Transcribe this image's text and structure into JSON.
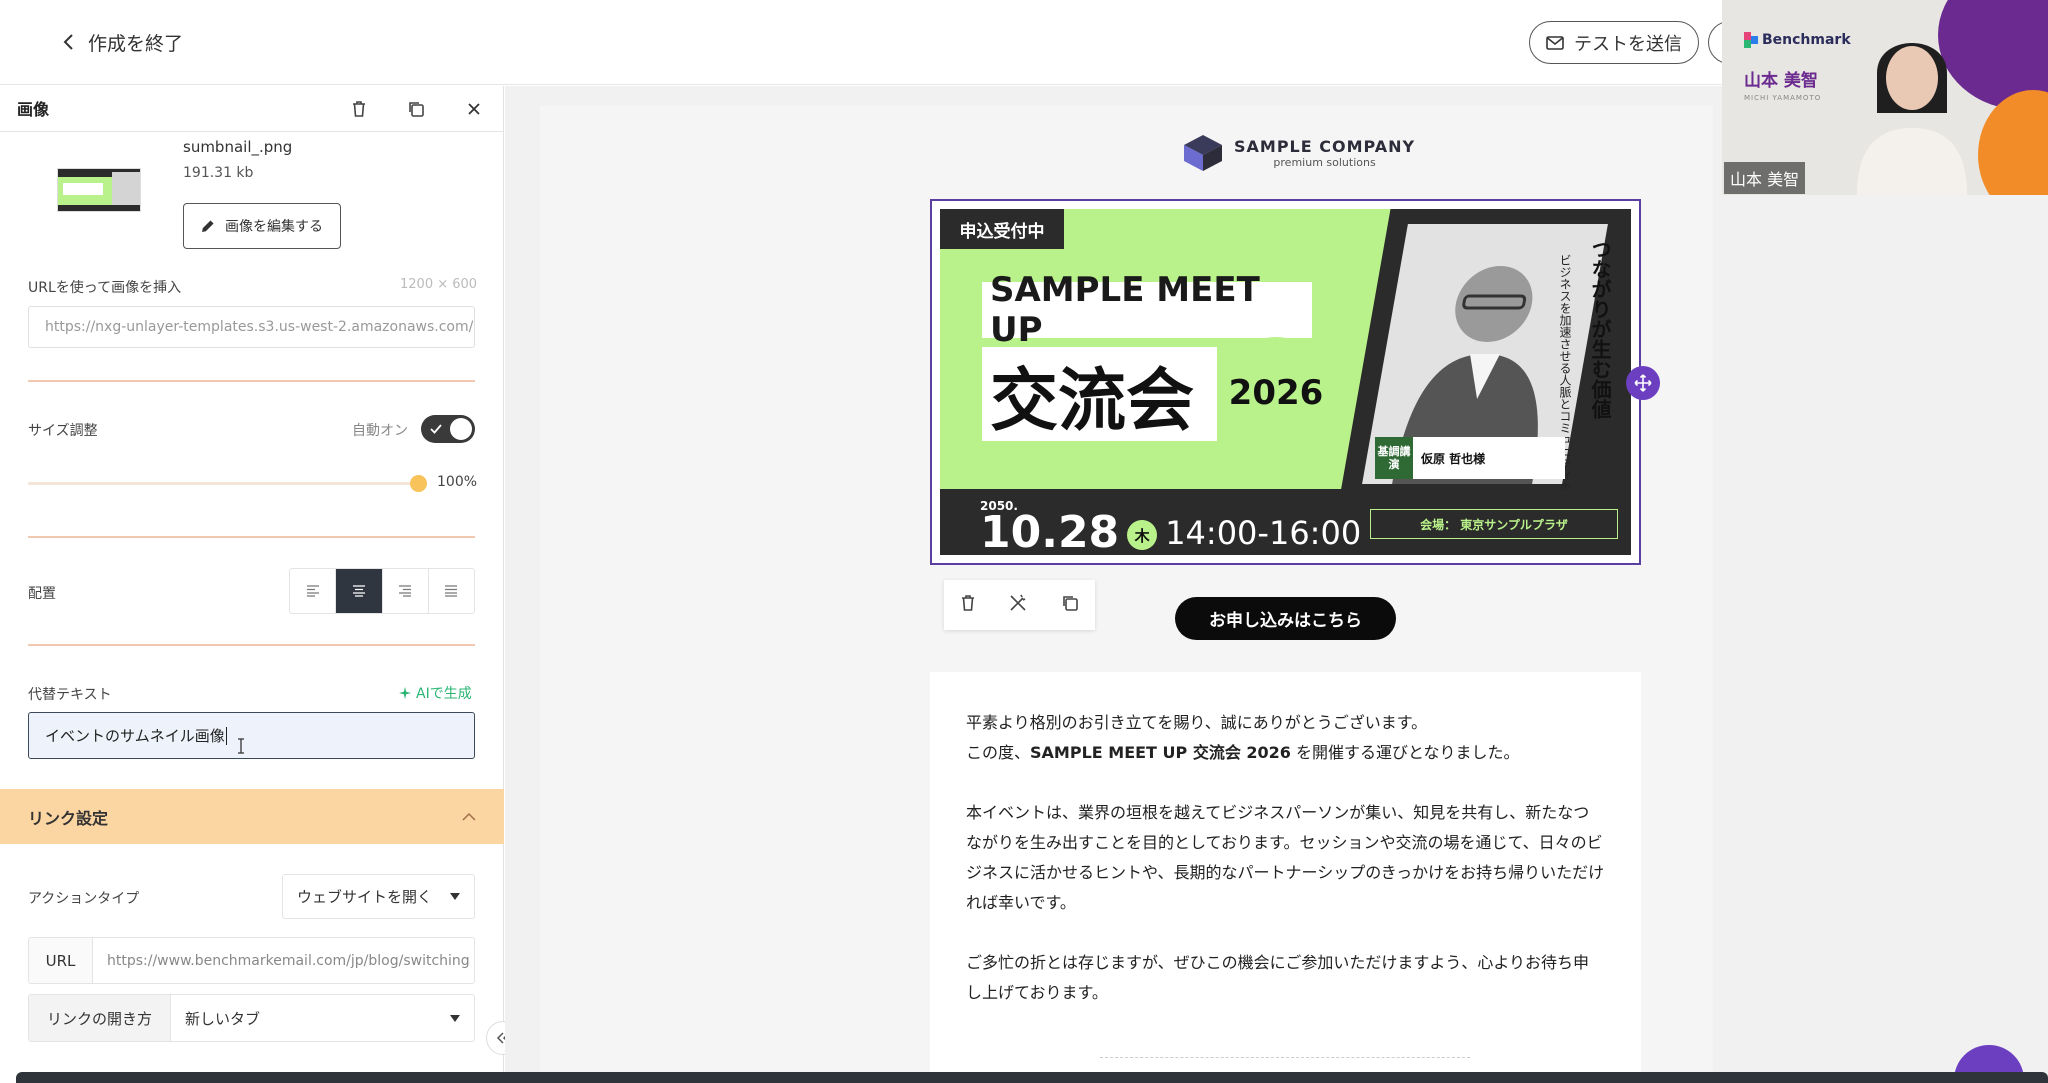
{
  "topbar": {
    "back_label": "作成を終了",
    "test_label": "テストを送信"
  },
  "panel": {
    "title": "画像",
    "file_name": "sumbnail_.png",
    "file_size": "191.31 kb",
    "edit_label": "画像を編集する",
    "url_label": "URLを使って画像を挿入",
    "dims": "1200 × 600",
    "url_value": "https://nxg-unlayer-templates.s3.us-west-2.amazonaws.com/",
    "size_label": "サイズ調整",
    "auto_label": "自動オン",
    "size_pct": "100%",
    "size_fraction": 1.0,
    "align_label": "配置",
    "alt_label": "代替テキスト",
    "ai_label": "AIで生成",
    "alt_value": "イベントのサムネイル画像",
    "link_section": "リンク設定",
    "action_label": "アクションタイプ",
    "action_value": "ウェブサイトを開く",
    "url_field_label": "URL",
    "url_field_value": "https://www.benchmarkemail.com/jp/blog/switching",
    "open_label": "リンクの開き方",
    "open_value": "新しいタブ"
  },
  "email": {
    "logo_title": "SAMPLE COMPANY",
    "logo_sub": "premium solutions",
    "banner": {
      "badge": "申込受付中",
      "title": "SAMPLE MEET UP",
      "kor": "交流会",
      "year": "2026",
      "vertical": "つながりが生む価値",
      "vertical_sub": "ビジネスを加速させる人脈とコミュニティの力",
      "speaker_tag": "基調講演",
      "speaker_name": "仮原 哲也様",
      "date_year": "2050.",
      "date_day": "10.28",
      "weekday": "木",
      "time": "14:00-16:00",
      "venue": "会場： 東京サンプルプラザ"
    },
    "cta": "お申し込みはこちら",
    "p1_a": "平素より格別のお引き立てを賜り、誠にありがとうございます。",
    "p1_b": "この度、",
    "p1_bold": "SAMPLE MEET UP 交流会 2026",
    "p1_c": " を開催する運びとなりました。",
    "p2": "本イベントは、業界の垣根を越えてビジネスパーソンが集い、知見を共有し、新たなつながりを生み出すことを目的としております。セッションや交流の場を通じて、日々のビジネスに活かせるヒントや、長期的なパートナーシップのきっかけをお持ち帰りいただければ幸いです。",
    "p3": "ご多忙の折とは存じますが、ぜひこの機会にご参加いただけますよう、心よりお待ち申し上げております。"
  },
  "video": {
    "brand": "Benchmark",
    "name": "山本 美智",
    "name_en": "MICHI YAMAMOTO",
    "tag": "山本 美智"
  },
  "colors": {
    "accent_purple": "#6b3fc0",
    "link_header": "#fcd6a2",
    "banner_green": "#b9f28a"
  }
}
